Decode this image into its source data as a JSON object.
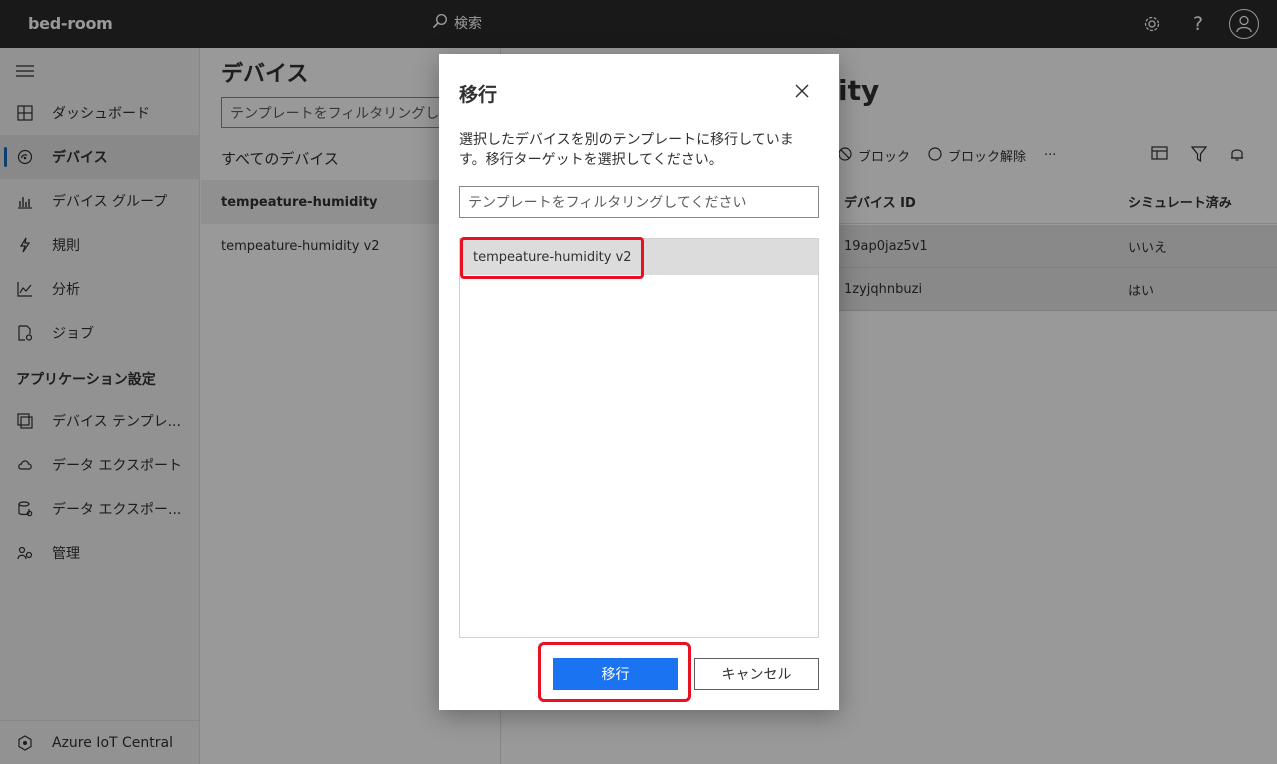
{
  "header": {
    "app_name": "bed-room",
    "search_label": "検索"
  },
  "sidebar": {
    "items": [
      {
        "label": "ダッシュボード",
        "icon": "dashboard-icon"
      },
      {
        "label": "デバイス",
        "icon": "devices-icon",
        "active": true
      },
      {
        "label": "デバイス グループ",
        "icon": "device-groups-icon"
      },
      {
        "label": "規則",
        "icon": "rules-icon"
      },
      {
        "label": "分析",
        "icon": "analytics-icon"
      },
      {
        "label": "ジョブ",
        "icon": "jobs-icon"
      }
    ],
    "section_title": "アプリケーション設定",
    "settings_items": [
      {
        "label": "デバイス テンプレ...",
        "icon": "device-templates-icon"
      },
      {
        "label": "データ エクスポート",
        "icon": "data-export-icon"
      },
      {
        "label": "データ エクスポー...",
        "icon": "data-export-legacy-icon"
      },
      {
        "label": "管理",
        "icon": "administration-icon"
      }
    ],
    "footer_label": "Azure IoT Central"
  },
  "middle": {
    "title": "デバイス",
    "filter_placeholder": "テンプレートをフィルタリングし",
    "all_devices": "すべてのデバイス",
    "templates": [
      "tempeature-humidity",
      "tempeature-humidity v2"
    ]
  },
  "right": {
    "title_fragment": "ity",
    "toolbar": {
      "block": "ブロック",
      "unblock": "ブロック解除",
      "more": "···"
    },
    "columns": [
      "デバイス ID",
      "シミュレート済み"
    ],
    "rows": [
      {
        "device_id": "19ap0jaz5v1",
        "simulated": "いいえ"
      },
      {
        "device_id": "1zyjqhnbuzi",
        "simulated": "はい"
      }
    ]
  },
  "dialog": {
    "title": "移行",
    "description": "選択したデバイスを別のテンプレートに移行していま す。移行ターゲットを選択してください。",
    "filter_placeholder": "テンプレートをフィルタリングしてください",
    "options": [
      "tempeature-humidity v2"
    ],
    "primary_label": "移行",
    "secondary_label": "キャンセル"
  },
  "colors": {
    "topbar": "#2b2b2b",
    "primary": "#1a73f0",
    "highlight": "#e81123",
    "active_indicator": "#0f6cbd"
  }
}
